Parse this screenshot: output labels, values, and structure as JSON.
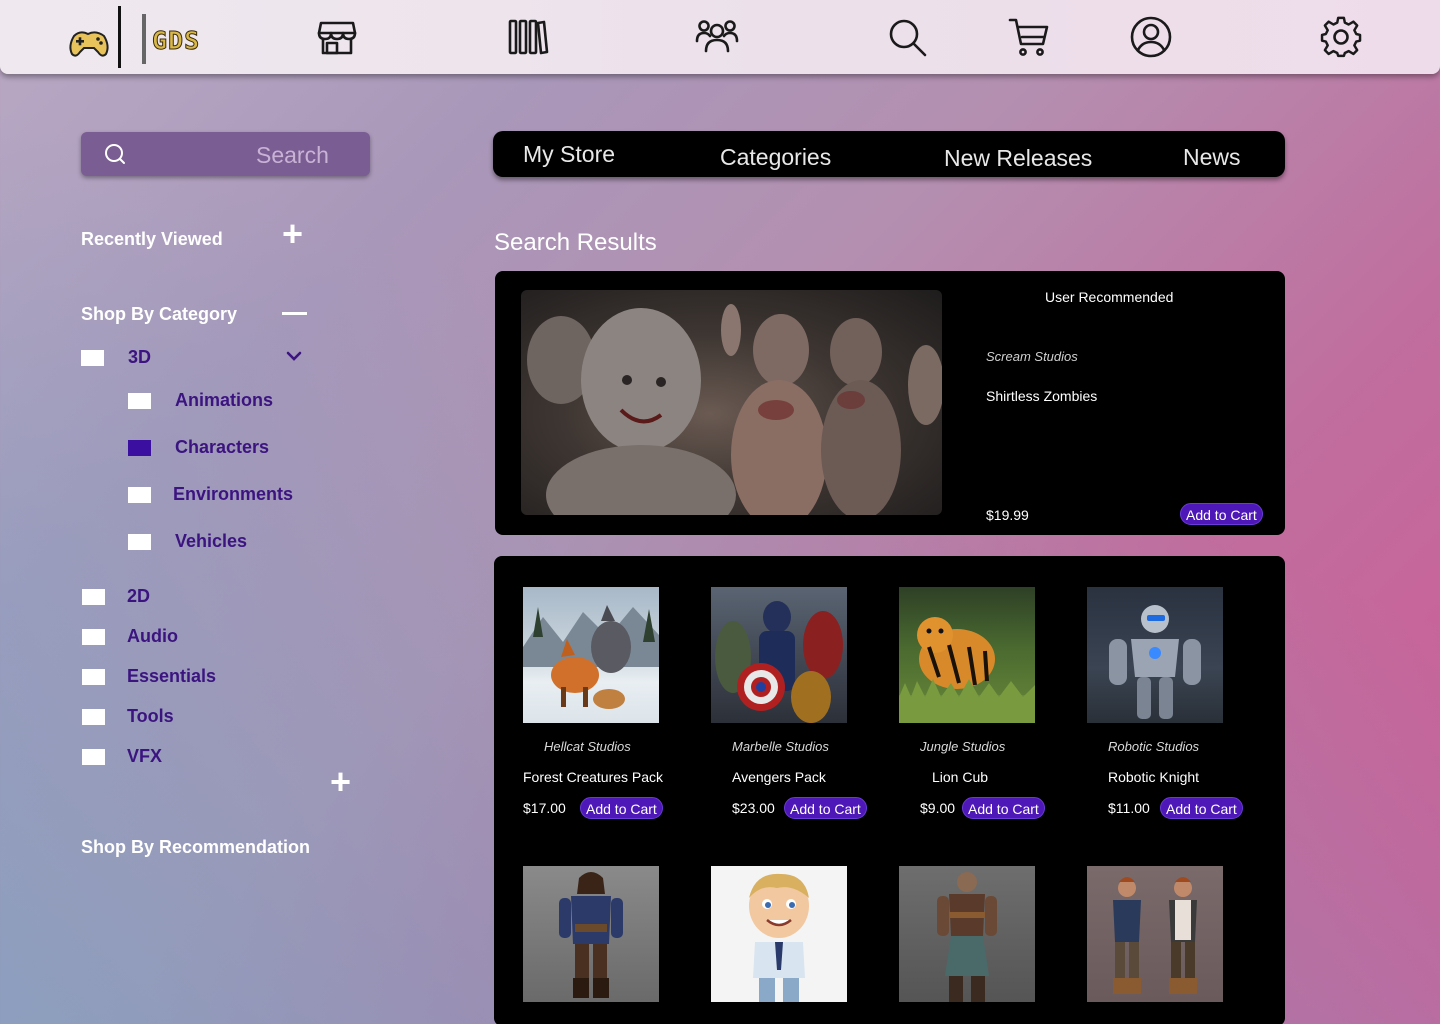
{
  "logo": {
    "text": "GDS"
  },
  "search": {
    "placeholder": "Search"
  },
  "sidebar": {
    "recently_viewed": "Recently Viewed",
    "shop_by_category": "Shop By Category",
    "shop_by_recommendation": "Shop By Recommendation",
    "categories": [
      {
        "label": "3D",
        "checked": false
      },
      {
        "label": "Animations",
        "checked": false
      },
      {
        "label": "Characters",
        "checked": true
      },
      {
        "label": "Environments",
        "checked": false
      },
      {
        "label": "Vehicles",
        "checked": false
      },
      {
        "label": "2D",
        "checked": false
      },
      {
        "label": "Audio",
        "checked": false
      },
      {
        "label": "Essentials",
        "checked": false
      },
      {
        "label": "Tools",
        "checked": false
      },
      {
        "label": "VFX",
        "checked": false
      }
    ]
  },
  "tabs": [
    {
      "label": "My Store"
    },
    {
      "label": "Categories"
    },
    {
      "label": "New Releases"
    },
    {
      "label": "News"
    }
  ],
  "main": {
    "results_title": "Search Results",
    "featured": {
      "badge": "User Recommended",
      "studio": "Scream Studios",
      "name": "Shirtless Zombies",
      "price": "$19.99",
      "cart_label": "Add to Cart"
    },
    "products": [
      {
        "studio": "Hellcat Studios",
        "name": "Forest Creatures Pack",
        "price": "$17.00",
        "cart_label": "Add to Cart"
      },
      {
        "studio": "Marbelle Studios",
        "name": "Avengers Pack",
        "price": "$23.00",
        "cart_label": "Add to Cart"
      },
      {
        "studio": "Jungle Studios",
        "name": "Lion Cub",
        "price": "$9.00",
        "cart_label": "Add to Cart"
      },
      {
        "studio": "Robotic Studios",
        "name": "Robotic Knight",
        "price": "$11.00",
        "cart_label": "Add to Cart"
      }
    ]
  },
  "colors": {
    "accent": "#4e18b8",
    "category_text": "#3b1480",
    "checked_box": "#3b0fa0"
  }
}
